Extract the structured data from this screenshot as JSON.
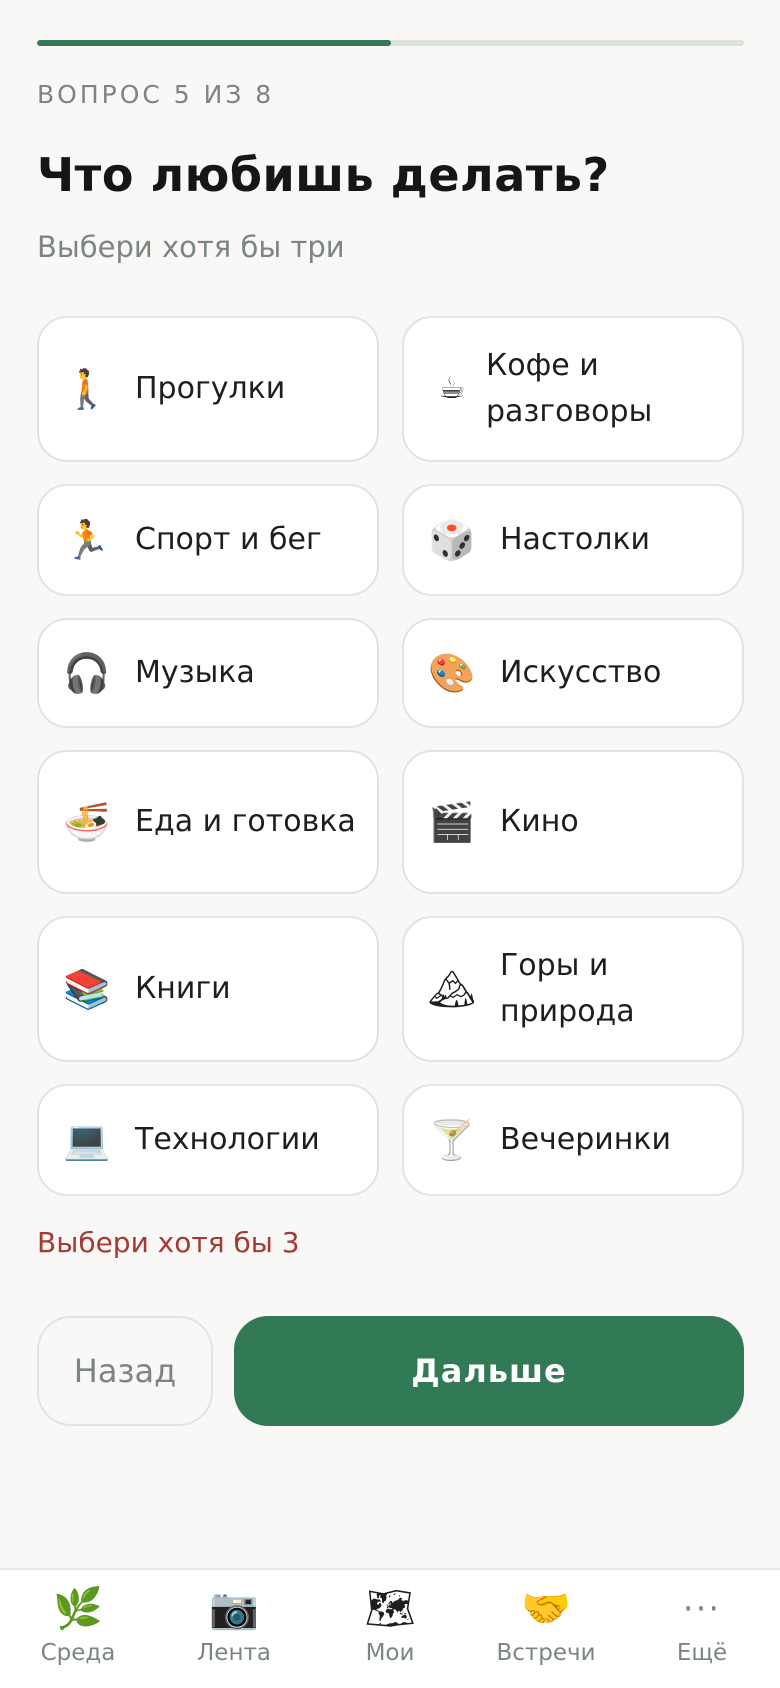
{
  "progress": {
    "fraction": 0.5
  },
  "step_label": "ВОПРОС 5 ИЗ 8",
  "title": "Что любишь делать?",
  "subtitle": "Выбери хотя бы три",
  "options": [
    {
      "icon": "🚶",
      "icon_name": "walking-person-icon",
      "label": "Прогулки"
    },
    {
      "icon": "☕",
      "icon_name": "coffee-cup-icon",
      "label": "Кофе и разговоры"
    },
    {
      "icon": "🏃",
      "icon_name": "running-person-icon",
      "label": "Спорт и бег"
    },
    {
      "icon": "🎲",
      "icon_name": "dice-icon",
      "label": "Настолки"
    },
    {
      "icon": "🎧",
      "icon_name": "headphones-icon",
      "label": "Музыка"
    },
    {
      "icon": "🎨",
      "icon_name": "palette-icon",
      "label": "Искусство"
    },
    {
      "icon": "🍜",
      "icon_name": "noodle-bowl-icon",
      "label": "Еда и готовка"
    },
    {
      "icon": "🎬",
      "icon_name": "clapperboard-icon",
      "label": "Кино"
    },
    {
      "icon": "📚",
      "icon_name": "books-icon",
      "label": "Книги"
    },
    {
      "icon": "🏔",
      "icon_name": "mountain-icon",
      "label": "Горы и природа"
    },
    {
      "icon": "💻",
      "icon_name": "laptop-icon",
      "label": "Технологии"
    },
    {
      "icon": "🍸",
      "icon_name": "cocktail-glass-icon",
      "label": "Вечеринки"
    }
  ],
  "error_text": "Выбери хотя бы 3",
  "buttons": {
    "back": "Назад",
    "next": "Дальше"
  },
  "nav": [
    {
      "icon": "🌿",
      "icon_name": "herb-icon",
      "label": "Среда"
    },
    {
      "icon": "📷",
      "icon_name": "camera-icon",
      "label": "Лента"
    },
    {
      "icon": "🗺",
      "icon_name": "map-icon",
      "label": "Мои"
    },
    {
      "icon": "🤝",
      "icon_name": "handshake-icon",
      "label": "Встречи"
    },
    {
      "icon": "···",
      "icon_name": "more-dots-icon",
      "label": "Ещё"
    }
  ],
  "colors": {
    "accent": "#327a56",
    "error": "#a53a32",
    "muted": "#7c8680",
    "background": "#f9f8f6"
  }
}
